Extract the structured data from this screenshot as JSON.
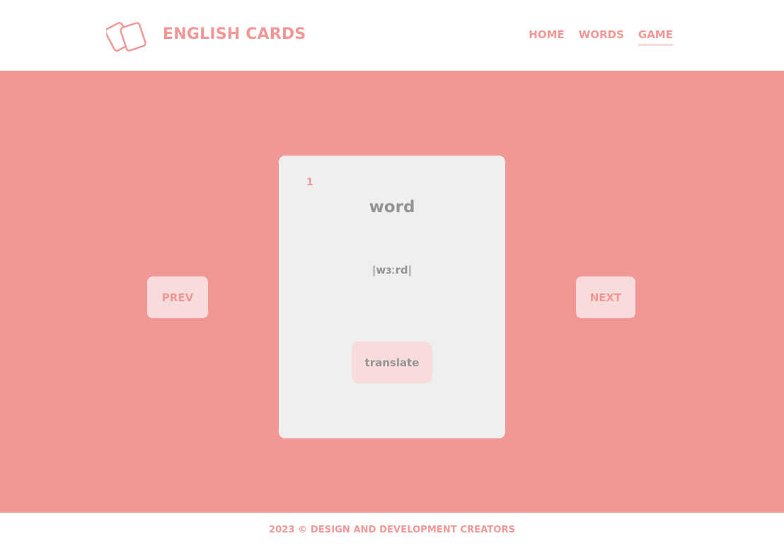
{
  "header": {
    "logo_icon": "cards-icon",
    "brand": "ENGLISH CARDS",
    "nav": [
      {
        "label": "HOME",
        "active": false
      },
      {
        "label": "WORDS",
        "active": false
      },
      {
        "label": "GAME",
        "active": true
      }
    ]
  },
  "game": {
    "prev_label": "PREV",
    "next_label": "NEXT",
    "card": {
      "number": "1",
      "word": "word",
      "transcription": "|wɜːrd|",
      "translate_label": "translate"
    }
  },
  "footer": {
    "text": "2023 © DESIGN AND DEVELOPMENT CREATORS"
  },
  "colors": {
    "accent": "#f19896",
    "button_bg": "#f8dcdc",
    "card_bg": "#efefef",
    "text_gray": "#949494"
  }
}
